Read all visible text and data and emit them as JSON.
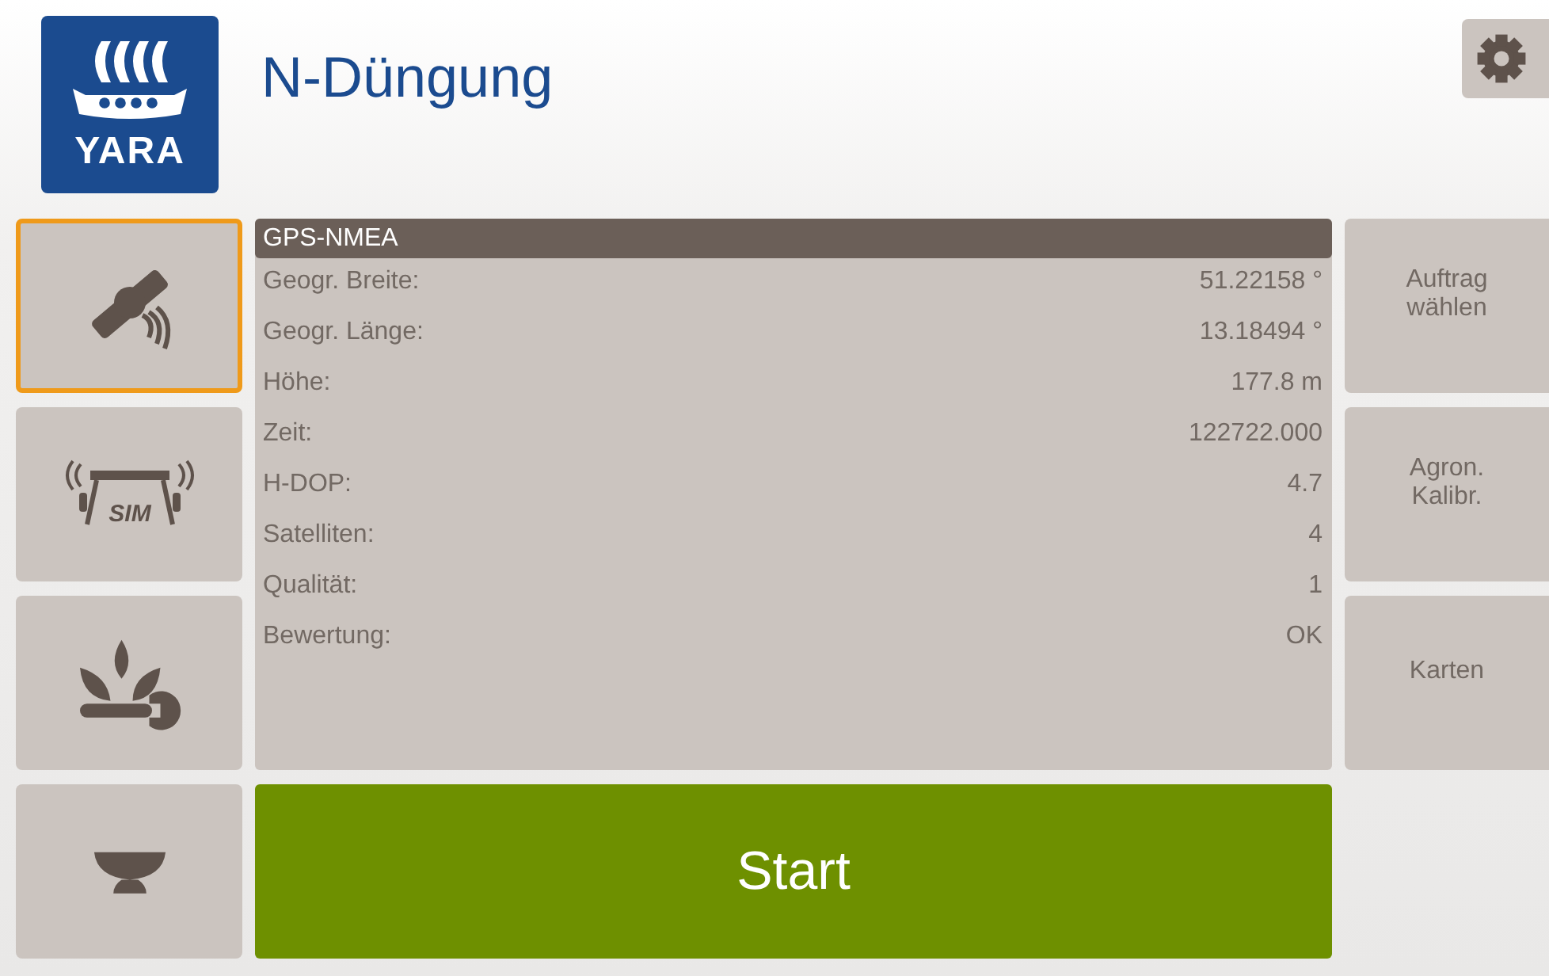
{
  "logo": {
    "text": "YARA"
  },
  "title": "N-Düngung",
  "sidebar": [
    {
      "kind": "satellite",
      "selected": true
    },
    {
      "kind": "sim",
      "label": "SIM",
      "selected": false
    },
    {
      "kind": "plant",
      "selected": false
    },
    {
      "kind": "bowl",
      "selected": false
    }
  ],
  "panel": {
    "title": "GPS-NMEA",
    "rows": [
      {
        "label": "Geogr. Breite:",
        "value": "51.22158 °"
      },
      {
        "label": "Geogr. Länge:",
        "value": "13.18494 °"
      },
      {
        "label": "Höhe:",
        "value": "177.8 m"
      },
      {
        "label": "Zeit:",
        "value": "122722.000"
      },
      {
        "label": "H-DOP:",
        "value": "4.7"
      },
      {
        "label": "Satelliten:",
        "value": "4"
      },
      {
        "label": "Qualität:",
        "value": "1"
      },
      {
        "label": "Bewertung:",
        "value": "OK"
      }
    ]
  },
  "start_button": "Start",
  "right_buttons": [
    {
      "lines": [
        "Auftrag",
        "wählen"
      ]
    },
    {
      "lines": [
        "Agron.",
        "Kalibr."
      ]
    },
    {
      "lines": [
        "Karten"
      ]
    }
  ]
}
